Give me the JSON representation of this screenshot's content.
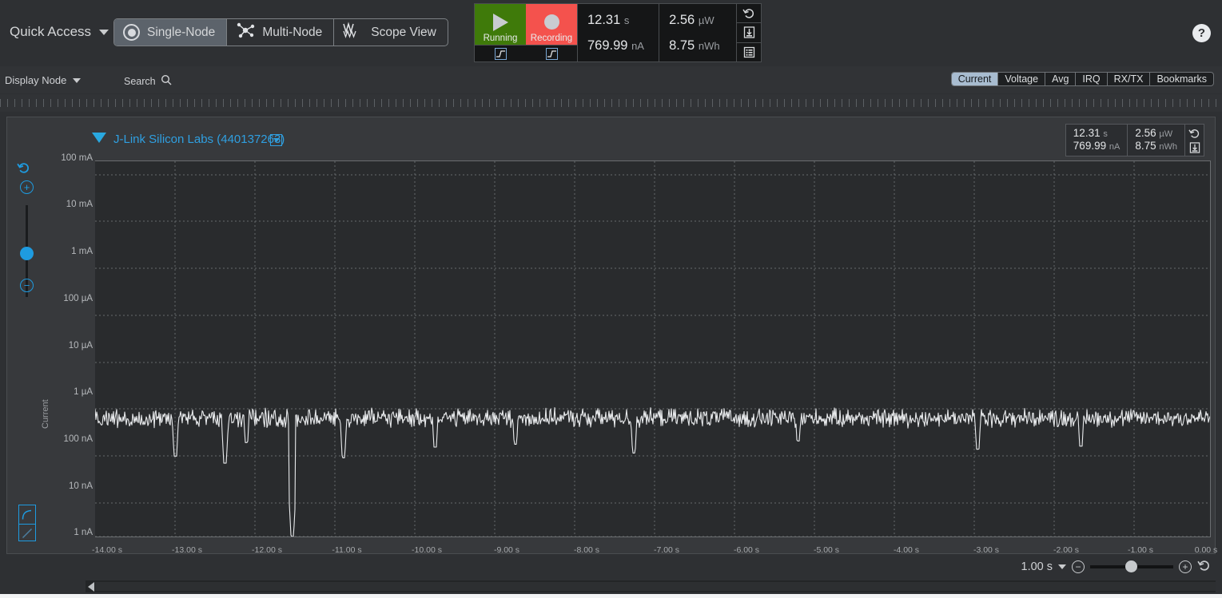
{
  "topbar": {
    "quick_access_label": "Quick Access",
    "modes": [
      {
        "label": "Single-Node",
        "icon": "single-node-icon",
        "active": true
      },
      {
        "label": "Multi-Node",
        "icon": "multi-node-icon",
        "active": false
      },
      {
        "label": "Scope View",
        "icon": "scope-view-icon",
        "active": false
      }
    ],
    "help_glyph": "?"
  },
  "control_panel": {
    "run_label": "Running",
    "record_label": "Recording",
    "edge_icons": [
      "rising-edge-icon",
      "rising-edge-icon",
      "falling-edge-icon"
    ],
    "stats": {
      "time": "12.31",
      "time_unit": "s",
      "current": "769.99",
      "current_unit": "nA",
      "power": "2.56",
      "power_unit": "µW",
      "energy": "8.75",
      "energy_unit": "nWh"
    },
    "side_icons": [
      "reset-icon",
      "save-icon",
      "log-icon"
    ]
  },
  "subbar": {
    "display_node_label": "Display Node",
    "search_label": "Search",
    "tabs": [
      {
        "label": "Current",
        "active": true
      },
      {
        "label": "Voltage",
        "active": false
      },
      {
        "label": "Avg",
        "active": false
      },
      {
        "label": "IRQ",
        "active": false
      },
      {
        "label": "RX/TX",
        "active": false
      },
      {
        "label": "Bookmarks",
        "active": false
      }
    ]
  },
  "chart_panel": {
    "node_title": "J-Link Silicon Labs (440137263)",
    "overlay": {
      "time": "12.31",
      "time_unit": "s",
      "current": "769.99",
      "current_unit": "nA",
      "power": "2.56",
      "power_unit": "µW",
      "energy": "8.75",
      "energy_unit": "nWh"
    },
    "vzoom": {
      "reset_icon": "reset-icon",
      "zoom_in_label": "+",
      "zoom_out_label": "−"
    },
    "scale_toggle": [
      "log-scale-icon",
      "linear-scale-icon"
    ]
  },
  "bottom": {
    "zoom_value": "1.00 s",
    "zoom_out_label": "−",
    "zoom_in_label": "+",
    "reset_icon": "reset-icon"
  },
  "chart_data": {
    "type": "line",
    "title": "J-Link Silicon Labs (440137263)",
    "xlabel": "",
    "ylabel": "Current",
    "yscale": "log",
    "grid": true,
    "legend": false,
    "line_color": "#e8eaec",
    "plot_bg": "#292b2d",
    "xlim": [
      -14.6,
      0.0
    ],
    "ylim_labels": [
      "1 nA",
      "100 mA"
    ],
    "xticks": [
      "-14.00 s",
      "-13.00 s",
      "-12.00 s",
      "-11.00 s",
      "-10.00 s",
      "-9.00 s",
      "-8.00 s",
      "-7.00 s",
      "-6.00 s",
      "-5.00 s",
      "-4.00 s",
      "-3.00 s",
      "-2.00 s",
      "-1.00 s",
      "0.00 s"
    ],
    "xtick_values": [
      -14,
      -13,
      -12,
      -11,
      -10,
      -9,
      -8,
      -7,
      -6,
      -5,
      -4,
      -3,
      -2,
      -1,
      0
    ],
    "yticks": [
      "100 mA",
      "10 mA",
      "1 mA",
      "100 µA",
      "10 µA",
      "1 µA",
      "100 nA",
      "10 nA",
      "1 nA"
    ],
    "ytick_values_nA": [
      100000000,
      10000000,
      1000000,
      100000,
      10000,
      1000,
      100,
      10,
      1
    ],
    "series": [
      {
        "name": "Current",
        "units": "nA",
        "description": "Noisy baseline around 300-600 nA with intermittent downward spikes; one deep dropout reaching ~1 nA near -12.0 s",
        "baseline_nA": 420,
        "noise_band_nA": [
          230,
          760
        ],
        "spikes": [
          {
            "t": -13.55,
            "min_nA": 60
          },
          {
            "t": -12.9,
            "min_nA": 42
          },
          {
            "t": -12.62,
            "min_nA": 120
          },
          {
            "t": -12.02,
            "min_nA": 1.0
          },
          {
            "t": -11.35,
            "min_nA": 55
          },
          {
            "t": -10.15,
            "min_nA": 95
          },
          {
            "t": -9.1,
            "min_nA": 110
          },
          {
            "t": -7.55,
            "min_nA": 70
          },
          {
            "t": -5.4,
            "min_nA": 130
          },
          {
            "t": -3.05,
            "min_nA": 85
          },
          {
            "t": -1.7,
            "min_nA": 100
          }
        ]
      }
    ]
  }
}
